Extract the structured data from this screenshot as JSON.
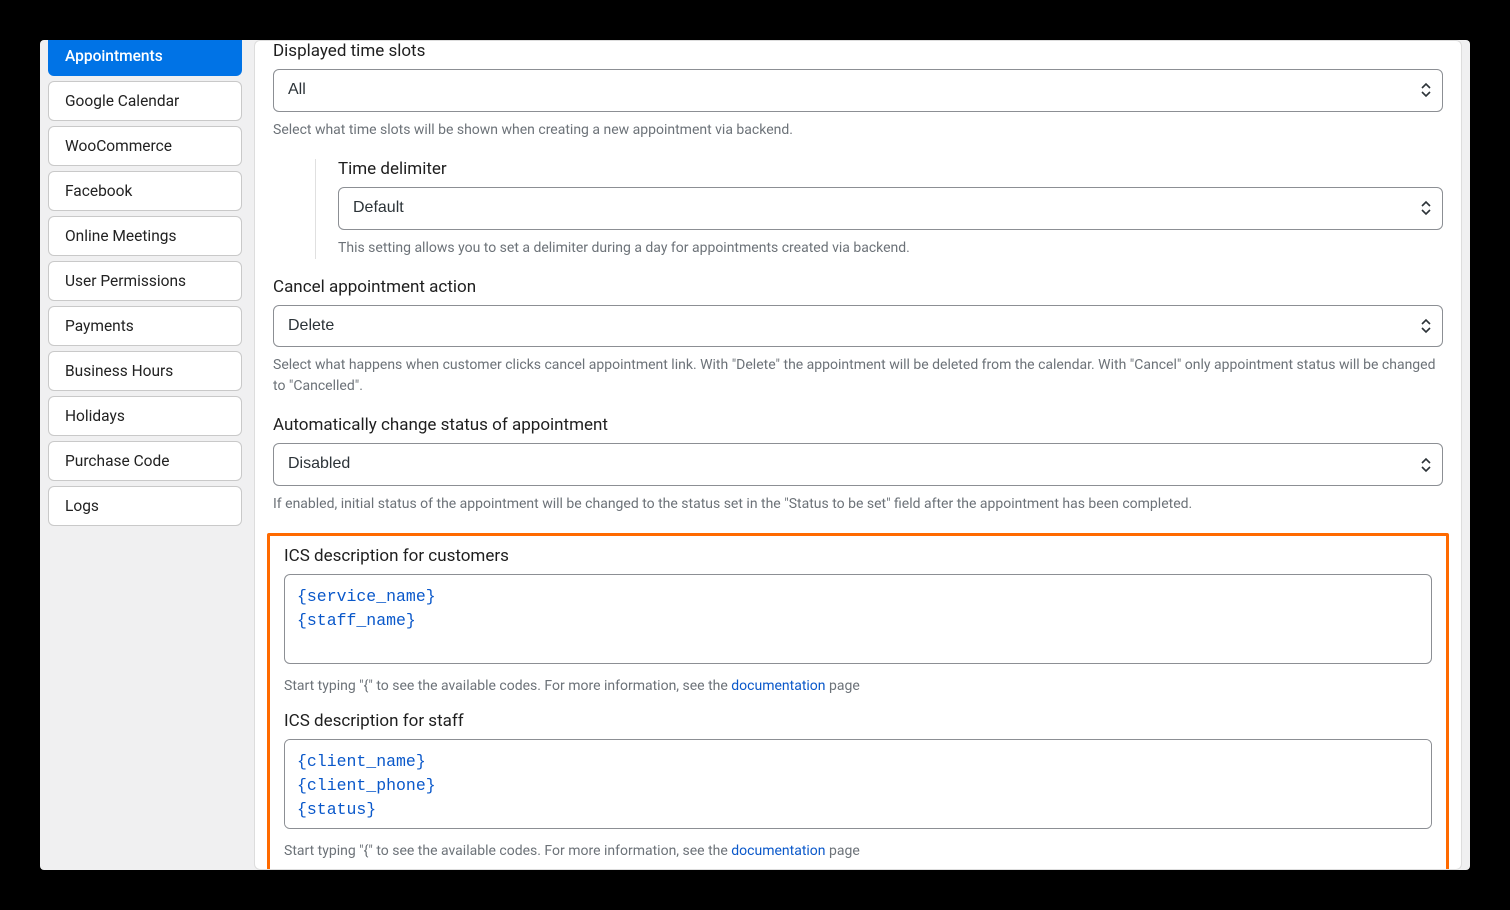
{
  "sidebar": {
    "items": [
      {
        "label": "Appointments",
        "active": true
      },
      {
        "label": "Google Calendar",
        "active": false
      },
      {
        "label": "WooCommerce",
        "active": false
      },
      {
        "label": "Facebook",
        "active": false
      },
      {
        "label": "Online Meetings",
        "active": false
      },
      {
        "label": "User Permissions",
        "active": false
      },
      {
        "label": "Payments",
        "active": false
      },
      {
        "label": "Business Hours",
        "active": false
      },
      {
        "label": "Holidays",
        "active": false
      },
      {
        "label": "Purchase Code",
        "active": false
      },
      {
        "label": "Logs",
        "active": false
      }
    ]
  },
  "settings": {
    "displayed_time_slots": {
      "label": "Displayed time slots",
      "value": "All",
      "help": "Select what time slots will be shown when creating a new appointment via backend."
    },
    "time_delimiter": {
      "label": "Time delimiter",
      "value": "Default",
      "help": "This setting allows you to set a delimiter during a day for appointments created via backend."
    },
    "cancel_action": {
      "label": "Cancel appointment action",
      "value": "Delete",
      "help": "Select what happens when customer clicks cancel appointment link. With \"Delete\" the appointment will be deleted from the calendar. With \"Cancel\" only appointment status will be changed to \"Cancelled\"."
    },
    "auto_status": {
      "label": "Automatically change status of appointment",
      "value": "Disabled",
      "help": "If enabled, initial status of the appointment will be changed to the status set in the \"Status to be set\" field after the appointment has been completed."
    },
    "ics_customers": {
      "label": "ICS description for customers",
      "value": "{service_name}\n{staff_name}",
      "help_pre": "Start typing \"{\" to see the available codes. For more information, see the ",
      "help_link": "documentation",
      "help_post": " page"
    },
    "ics_staff": {
      "label": "ICS description for staff",
      "value": "{client_name}\n{client_phone}\n{status}",
      "help_pre": "Start typing \"{\" to see the available codes. For more information, see the ",
      "help_link": "documentation",
      "help_post": " page"
    }
  }
}
